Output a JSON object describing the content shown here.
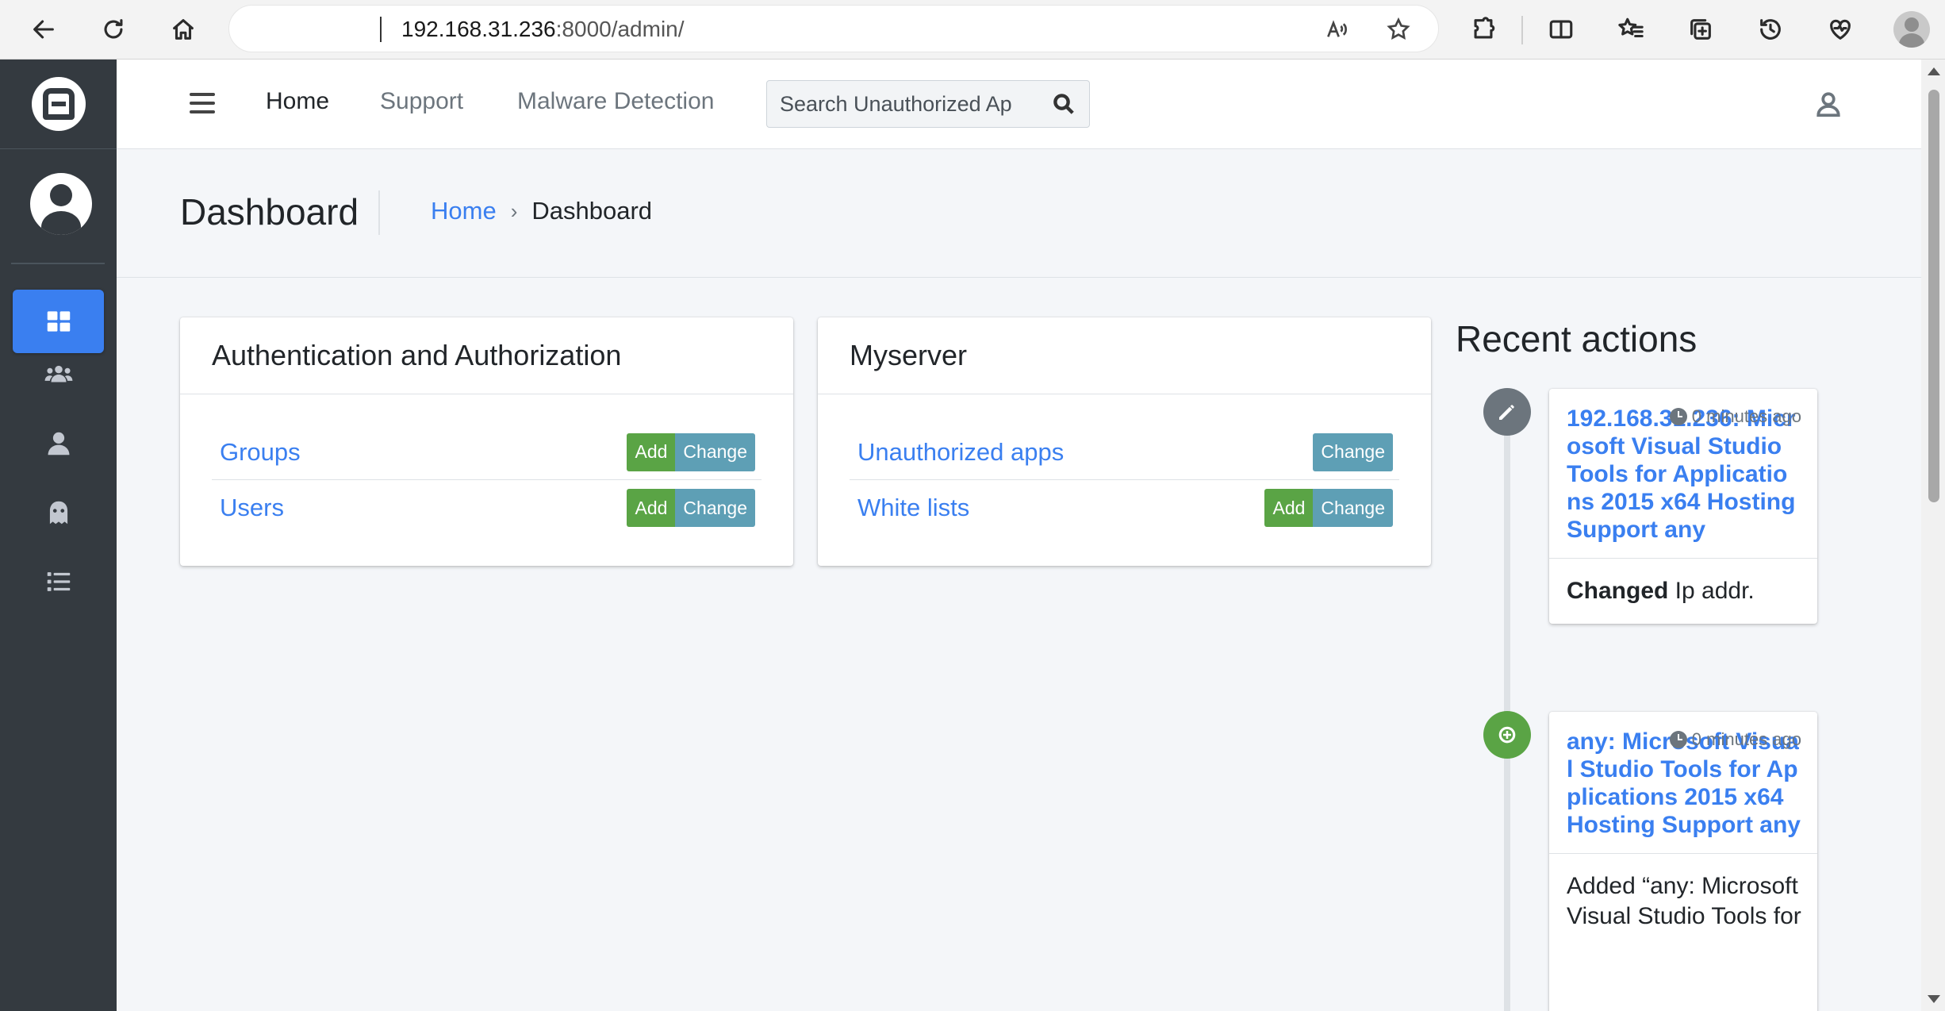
{
  "browser": {
    "url_host": "192.168.31.236",
    "url_rest": ":8000/admin/"
  },
  "navbar": {
    "links": [
      "Home",
      "Support",
      "Malware Detection"
    ],
    "search_placeholder": "Search Unauthorized Ap"
  },
  "header": {
    "title": "Dashboard",
    "breadcrumb": {
      "home": "Home",
      "separator": "›",
      "current": "Dashboard"
    }
  },
  "apps": [
    {
      "title": "Authentication and Authorization",
      "models": [
        {
          "name": "Groups",
          "add": "Add",
          "change": "Change"
        },
        {
          "name": "Users",
          "add": "Add",
          "change": "Change"
        }
      ]
    },
    {
      "title": "Myserver",
      "models": [
        {
          "name": "Unauthorized apps",
          "change": "Change"
        },
        {
          "name": "White lists",
          "add": "Add",
          "change": "Change"
        }
      ]
    }
  ],
  "recent": {
    "title": "Recent actions",
    "items": [
      {
        "type": "changed",
        "link": "192.168.31.236: Microsoft Visual Studio Tools for Applications 2015 x64 Hosting Support any",
        "time": "0 minutes ago",
        "verb": "Changed",
        "detail": " Ip addr."
      },
      {
        "type": "added",
        "link": "any: Microsoft Visual Studio Tools for Applications 2015 x64 Hosting Support any",
        "time": "0 minutes ago",
        "detail": "Added “any: Microsoft Visual Studio Tools for"
      }
    ]
  },
  "colors": {
    "sidebar": "#343a40",
    "accent": "#3a7ff0",
    "add_button": "#5aa445",
    "change_button": "#5e9fb5"
  }
}
